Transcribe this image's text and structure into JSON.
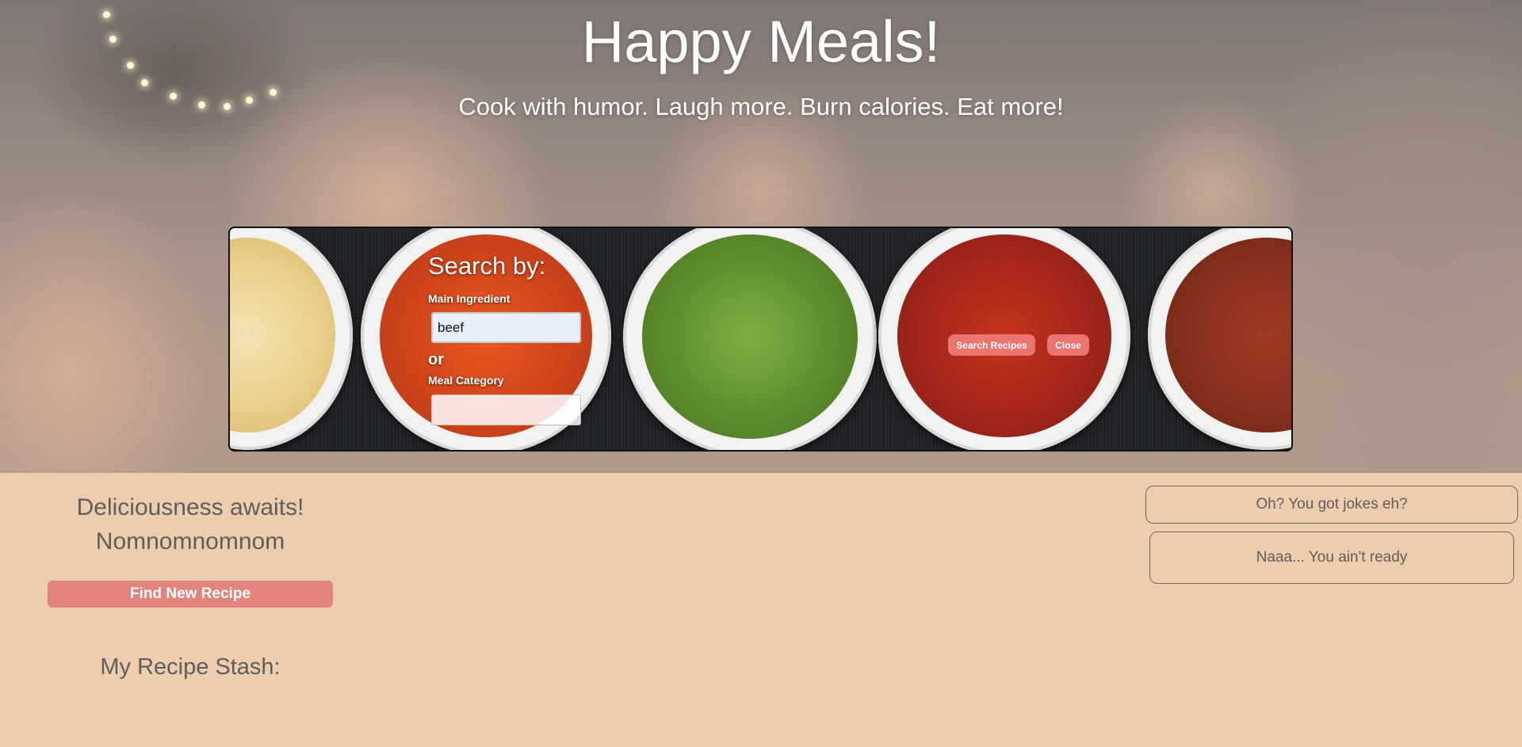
{
  "header": {
    "title": "Happy Meals!",
    "subtitle": "Cook with humor. Laugh more. Burn calories. Eat more!"
  },
  "search_panel": {
    "heading": "Search by:",
    "main_ingredient_label": "Main Ingredient",
    "main_ingredient_value": "beef",
    "or_label": "or",
    "meal_category_label": "Meal Category",
    "meal_category_value": "",
    "search_button": "Search Recipes",
    "close_button": "Close"
  },
  "main": {
    "tagline_line1": "Deliciousness awaits!",
    "tagline_line2": "Nomnomnomnom",
    "find_button": "Find New Recipe",
    "stash_title": "My Recipe Stash:"
  },
  "jokes": {
    "prompt": "Oh? You got jokes eh?",
    "response": "Naaa... You ain't ready"
  },
  "colors": {
    "page_background": "#eccdae",
    "accent_button": "#e2837d",
    "pill_button": "#e9756e",
    "text_muted": "#5e5e5e"
  }
}
